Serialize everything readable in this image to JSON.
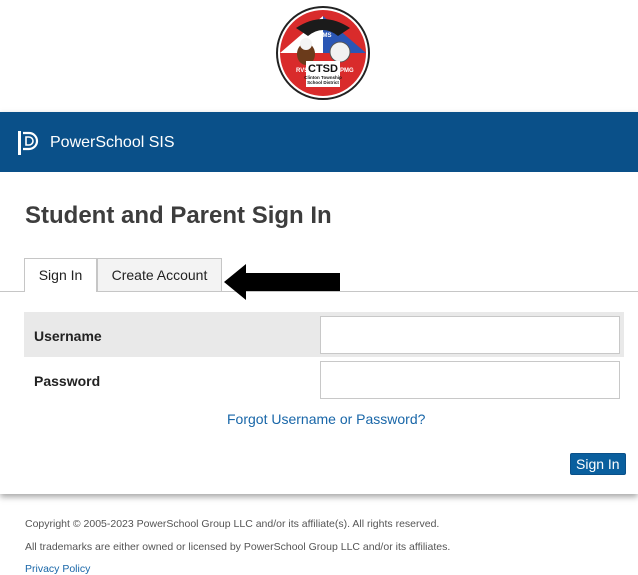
{
  "logo": {
    "top_text": "CTMS",
    "left_text": "RVS",
    "right_text": "PMG",
    "main_text": "CTSD",
    "sub_text_1": "Clinton Township",
    "sub_text_2": "School District"
  },
  "header": {
    "brand_name": "PowerSchool SIS",
    "brand_icon": "powerschool-logo-icon",
    "bar_color": "#0a5089"
  },
  "main": {
    "title": "Student and Parent Sign In",
    "tabs": [
      {
        "label": "Sign In",
        "active": true
      },
      {
        "label": "Create Account",
        "active": false
      }
    ],
    "annotation_arrow": "left-arrow-icon",
    "form": {
      "username_label": "Username",
      "username_value": "",
      "password_label": "Password",
      "password_value": "",
      "forgot_link": "Forgot Username or Password?",
      "submit_label": "Sign In"
    }
  },
  "footer": {
    "copyright": "Copyright © 2005-2023 PowerSchool Group LLC and/or its affiliate(s). All rights reserved.",
    "trademarks": "All trademarks are either owned or licensed by PowerSchool Group LLC and/or its affiliates.",
    "privacy": "Privacy Policy"
  }
}
